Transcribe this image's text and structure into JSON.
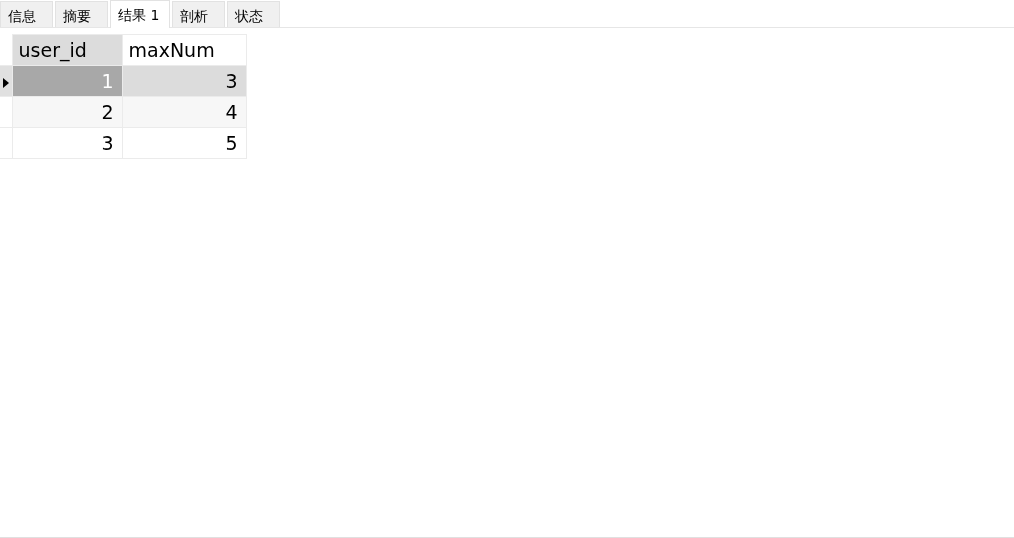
{
  "tabs": [
    {
      "label": "信息",
      "selected": false
    },
    {
      "label": "摘要",
      "selected": false
    },
    {
      "label": "结果 1",
      "selected": true
    },
    {
      "label": "剖析",
      "selected": false
    },
    {
      "label": "状态",
      "selected": false
    }
  ],
  "table": {
    "columns": [
      {
        "label": "user_id",
        "selected": true
      },
      {
        "label": "maxNum",
        "selected": false
      }
    ],
    "rows": [
      {
        "selected": true,
        "cells": [
          "1",
          "3"
        ]
      },
      {
        "selected": false,
        "cells": [
          "2",
          "4"
        ]
      },
      {
        "selected": false,
        "cells": [
          "3",
          "5"
        ]
      }
    ]
  }
}
